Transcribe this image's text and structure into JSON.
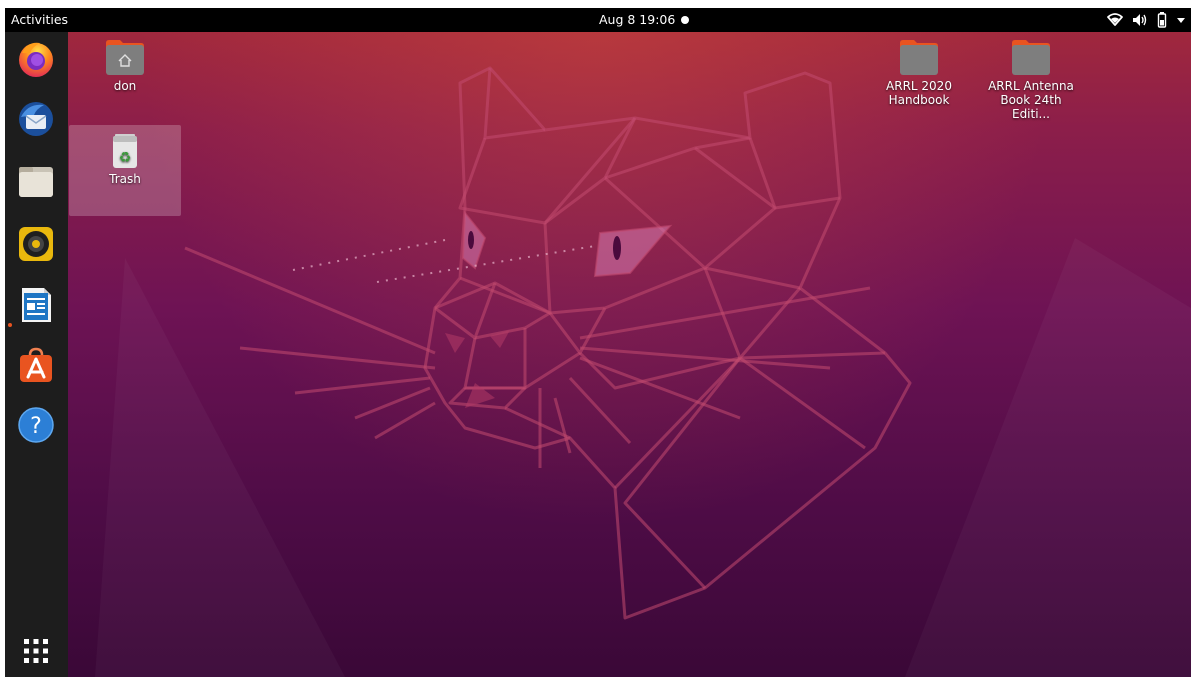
{
  "topbar": {
    "activities_label": "Activities",
    "clock": "Aug 8  19:06",
    "tray_icons": [
      "wifi-icon",
      "volume-icon",
      "battery-icon",
      "menu-arrow-icon"
    ]
  },
  "dock": {
    "apps": [
      {
        "name": "Firefox",
        "icon": "firefox-icon"
      },
      {
        "name": "Thunderbird",
        "icon": "thunderbird-icon"
      },
      {
        "name": "Files",
        "icon": "files-icon"
      },
      {
        "name": "Rhythmbox",
        "icon": "rhythmbox-icon"
      },
      {
        "name": "LibreOffice Writer",
        "icon": "writer-icon",
        "running": true
      },
      {
        "name": "Ubuntu Software",
        "icon": "software-icon"
      },
      {
        "name": "Help",
        "icon": "help-icon"
      }
    ],
    "show_apps_icon": "grid-icon"
  },
  "desktop": {
    "icons": [
      {
        "label": "don",
        "type": "home-folder"
      },
      {
        "label": "Trash",
        "type": "trash",
        "selected": true
      },
      {
        "label": "ARRL 2020\nHandbook",
        "type": "folder"
      },
      {
        "label": "ARRL Antenna\nBook 24th Editi...",
        "type": "folder"
      }
    ]
  },
  "colors": {
    "topbar": "#000000",
    "dock": "#1d1d1d",
    "accent": "#e95420",
    "wallpaper_top": "#a52a3a",
    "wallpaper_bottom": "#3a0837"
  }
}
